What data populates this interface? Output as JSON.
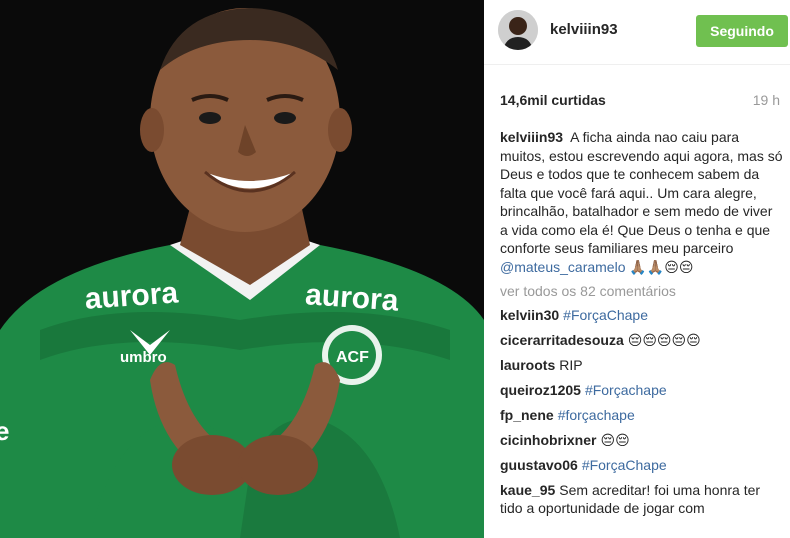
{
  "post": {
    "username": "kelviiin93",
    "follow_label": "Seguindo",
    "likes": "14,6mil curtidas",
    "time": "19 h",
    "caption_user": "kelviiin93",
    "caption_text": "A ficha ainda nao caiu para muitos, estou escrevendo aqui agora, mas só Deus e todos que te conhecem sabem da falta que você fará aqui.. Um cara alegre, brincalhão, batalhador e sem medo de viver a vida como ela é! Que Deus o tenha e que conforte seus familiares meu parceiro",
    "caption_mention": "@mateus_caramelo",
    "caption_emoji": "🙏🏽🙏🏽😔😔",
    "view_all": "ver todos os 82 comentários"
  },
  "photo": {
    "jersey_brand_left": "aurora",
    "jersey_brand_right": "aurora",
    "jersey_maker": "umbro",
    "crest_text": "ACF",
    "colors": {
      "jersey": "#1e8a46",
      "jersey_dark": "#136632",
      "skin": "#8b5a3c",
      "background": "#0a0a0a"
    }
  },
  "comments": [
    {
      "user": "kelviin30",
      "text": "#ForçaChape",
      "is_tag": true
    },
    {
      "user": "cicerarritadesouza",
      "text": "😔😔😔😔😔",
      "is_tag": false
    },
    {
      "user": "lauroots",
      "text": "RIP",
      "is_tag": false
    },
    {
      "user": "queiroz1205",
      "text": "#Forçachape",
      "is_tag": true
    },
    {
      "user": "fp_nene",
      "text": "#forçachape",
      "is_tag": true
    },
    {
      "user": "cicinhobrixner",
      "text": "😔😔",
      "is_tag": false
    },
    {
      "user": "guustavo06",
      "text": "#ForçaChape",
      "is_tag": true
    },
    {
      "user": "kaue_95",
      "text": "Sem acreditar! foi uma honra ter tido a oportunidade de jogar com",
      "is_tag": false
    }
  ],
  "colors": {
    "follow_button": "#70c050",
    "link": "#3d6a9f",
    "muted": "#999999"
  }
}
